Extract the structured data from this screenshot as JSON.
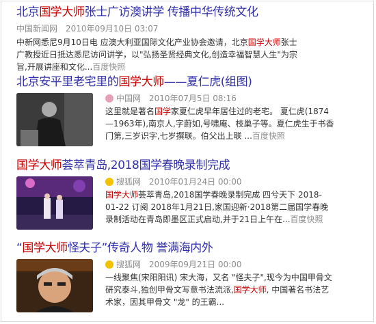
{
  "results": [
    {
      "title_a": "北京",
      "title_hl": "国学大师",
      "title_b": "张士广访澳讲学 传播中华传统文化",
      "source": "中国新闻网",
      "date": "2010年09月10日 03:07",
      "snippet_a": "中新网悉尼9月10日电 应澳大利亚国际文化产业协会邀请，北京",
      "snippet_hl": "国学大师",
      "snippet_b": "张士广教授近日抵达悉尼访问讲学，以\"弘扬圣贤经典文化,创造幸福智慧人生\"为宗旨,开展讲座和文化...",
      "snapshot": "百度快照"
    },
    {
      "title_a": "北京安平里老宅里的",
      "title_hl": "国学大师",
      "title_b": "——夏仁虎(组图)",
      "source": "中国网",
      "date": "2010年07月5日 08:16",
      "snippet_a": "这里就是著名",
      "snippet_hl": "国学",
      "snippet_b": "家夏仁虎早年居住过的老宅。 夏仁虎(1874—1963年),南京人,字蔚如,号啸庵、枝巢子等。夏仁虎生于书香门第,三岁识字,七岁撰联。伯父出上联 ...",
      "snapshot": "百度快照"
    },
    {
      "title_a": "",
      "title_hl": "国学大师",
      "title_b": "荟萃青岛,2018国学春晚录制完成",
      "source": "搜狐网",
      "date": "2010年01月24日 00:00",
      "snippet_a": "",
      "snippet_hl": "国学大师",
      "snippet_b": "荟萃青岛,2018国学春晚录制完成 四兮天下 2018-01-22 订阅 2018年1月21日,家国迎新·2018第二届国学春晚录制活动在青岛即墨区正式启动,并于21日上午在...",
      "snapshot": "百度快照"
    },
    {
      "title_a": "“",
      "title_hl": "国学大师",
      "title_b": "怪夫子”传奇人物 誉满海内外",
      "source": "搜狐网",
      "date": "2009年09月21日 00:00",
      "snippet_a": "一线聚焦(宋阳阳讯) 宋大海，又名 \"怪夫子\",现今为中国甲骨文研究泰斗,独创甲骨文写意书法流派,",
      "snippet_hl": "国学大师",
      "snippet_b": ", 中国著名书法艺术家，因其甲骨文 \"龙\" 的王霸...",
      "snapshot": "百度快照"
    }
  ],
  "colors": {
    "title": "#2f2fa8",
    "highlight": "#c80000",
    "meta": "#8c8c8c"
  },
  "icons": [
    "china-net-icon",
    "sohu-icon",
    "sohu-icon"
  ]
}
